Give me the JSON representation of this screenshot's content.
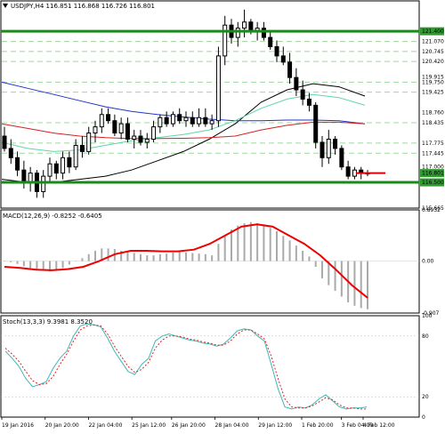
{
  "chart_data": {
    "type": "candlestick",
    "symbol": "USDJPY,H4",
    "ohlc_values": [
      "116.851",
      "116.868",
      "116.726",
      "116.801"
    ],
    "colors": {
      "background": "#ffffff",
      "panel_border": "#000000",
      "support_resistance": "#1a8a1a",
      "price_label_bg": "#2e9a2e",
      "level_dashed": "#9ed89e",
      "ma_black": "#000000",
      "ma_blue": "#2233cc",
      "ma_red": "#d62020",
      "ma_aqua": "#5ed6a8",
      "macd_hist": "#aaaaaa",
      "macd_signal": "#ee0000",
      "stoch_main": "#3fb8b8",
      "stoch_signal": "#dd2222",
      "current_price_line": "#dd0000",
      "candle_up_fill": "#ffffff",
      "candle_down_fill": "#000000"
    },
    "price_panel": {
      "ylim": [
        115.665,
        122.385
      ],
      "y_axis_labels": [
        "121.400",
        "121.070",
        "120.745",
        "120.420",
        "119.915",
        "119.750",
        "119.425",
        "118.760",
        "118.435",
        "117.775",
        "117.445",
        "117.000",
        "116.801",
        "116.500",
        "115.665"
      ],
      "highlighted_labels": [
        "121.400",
        "116.801",
        "116.500"
      ],
      "support_level": 116.5,
      "resistance_level": 121.4,
      "current_price": 116.801,
      "dashed_levels": [
        121.07,
        120.745,
        120.42,
        119.75,
        119.425,
        118.435,
        117.775,
        117.445
      ],
      "candles": [
        {
          "o": 118.0,
          "h": 118.3,
          "l": 117.5,
          "c": 117.6
        },
        {
          "o": 117.6,
          "h": 117.9,
          "l": 117.1,
          "c": 117.3
        },
        {
          "o": 117.3,
          "h": 117.5,
          "l": 116.7,
          "c": 116.9
        },
        {
          "o": 116.9,
          "h": 117.2,
          "l": 116.3,
          "c": 116.5
        },
        {
          "o": 116.5,
          "h": 117.0,
          "l": 116.2,
          "c": 116.8
        },
        {
          "o": 116.8,
          "h": 116.9,
          "l": 116.0,
          "c": 116.2
        },
        {
          "o": 116.2,
          "h": 116.9,
          "l": 116.0,
          "c": 116.7
        },
        {
          "o": 116.7,
          "h": 117.3,
          "l": 116.5,
          "c": 117.1
        },
        {
          "o": 117.1,
          "h": 117.2,
          "l": 116.6,
          "c": 116.8
        },
        {
          "o": 116.8,
          "h": 117.5,
          "l": 116.6,
          "c": 117.3
        },
        {
          "o": 117.3,
          "h": 117.5,
          "l": 116.8,
          "c": 117.0
        },
        {
          "o": 117.0,
          "h": 117.9,
          "l": 116.9,
          "c": 117.7
        },
        {
          "o": 117.7,
          "h": 118.0,
          "l": 117.3,
          "c": 117.5
        },
        {
          "o": 117.5,
          "h": 118.3,
          "l": 117.4,
          "c": 118.1
        },
        {
          "o": 118.1,
          "h": 118.5,
          "l": 117.8,
          "c": 118.3
        },
        {
          "o": 118.3,
          "h": 118.9,
          "l": 118.1,
          "c": 118.7
        },
        {
          "o": 118.7,
          "h": 118.9,
          "l": 118.4,
          "c": 118.5
        },
        {
          "o": 118.5,
          "h": 118.7,
          "l": 118.0,
          "c": 118.1
        },
        {
          "o": 118.1,
          "h": 118.6,
          "l": 117.9,
          "c": 118.4
        },
        {
          "o": 118.4,
          "h": 118.6,
          "l": 117.8,
          "c": 117.9
        },
        {
          "o": 117.9,
          "h": 118.2,
          "l": 117.6,
          "c": 118.0
        },
        {
          "o": 118.0,
          "h": 118.2,
          "l": 117.7,
          "c": 117.8
        },
        {
          "o": 117.8,
          "h": 118.1,
          "l": 117.6,
          "c": 117.9
        },
        {
          "o": 117.9,
          "h": 118.5,
          "l": 117.8,
          "c": 118.3
        },
        {
          "o": 118.3,
          "h": 118.7,
          "l": 118.1,
          "c": 118.6
        },
        {
          "o": 118.6,
          "h": 118.8,
          "l": 118.3,
          "c": 118.4
        },
        {
          "o": 118.4,
          "h": 118.8,
          "l": 118.3,
          "c": 118.7
        },
        {
          "o": 118.7,
          "h": 118.9,
          "l": 118.4,
          "c": 118.5
        },
        {
          "o": 118.5,
          "h": 118.8,
          "l": 118.3,
          "c": 118.6
        },
        {
          "o": 118.6,
          "h": 118.8,
          "l": 118.3,
          "c": 118.4
        },
        {
          "o": 118.4,
          "h": 118.9,
          "l": 118.3,
          "c": 118.6
        },
        {
          "o": 118.6,
          "h": 118.9,
          "l": 118.3,
          "c": 118.4
        },
        {
          "o": 118.4,
          "h": 118.7,
          "l": 118.2,
          "c": 118.5
        },
        {
          "o": 118.5,
          "h": 120.9,
          "l": 118.3,
          "c": 120.6
        },
        {
          "o": 120.6,
          "h": 121.9,
          "l": 120.3,
          "c": 121.6
        },
        {
          "o": 121.6,
          "h": 121.8,
          "l": 121.0,
          "c": 121.2
        },
        {
          "o": 121.2,
          "h": 121.7,
          "l": 120.9,
          "c": 121.5
        },
        {
          "o": 121.5,
          "h": 122.1,
          "l": 121.2,
          "c": 121.7
        },
        {
          "o": 121.7,
          "h": 121.8,
          "l": 121.3,
          "c": 121.4
        },
        {
          "o": 121.4,
          "h": 121.7,
          "l": 121.1,
          "c": 121.5
        },
        {
          "o": 121.5,
          "h": 121.7,
          "l": 121.1,
          "c": 121.2
        },
        {
          "o": 121.2,
          "h": 121.4,
          "l": 120.8,
          "c": 120.9
        },
        {
          "o": 120.9,
          "h": 121.1,
          "l": 120.4,
          "c": 120.6
        },
        {
          "o": 120.6,
          "h": 120.9,
          "l": 120.3,
          "c": 120.4
        },
        {
          "o": 120.4,
          "h": 120.7,
          "l": 119.7,
          "c": 119.9
        },
        {
          "o": 119.9,
          "h": 120.2,
          "l": 119.3,
          "c": 119.5
        },
        {
          "o": 119.5,
          "h": 119.8,
          "l": 119.0,
          "c": 119.2
        },
        {
          "o": 119.2,
          "h": 119.4,
          "l": 118.8,
          "c": 119.0
        },
        {
          "o": 119.0,
          "h": 119.1,
          "l": 117.6,
          "c": 117.8
        },
        {
          "o": 117.8,
          "h": 118.0,
          "l": 117.0,
          "c": 117.3
        },
        {
          "o": 117.3,
          "h": 118.2,
          "l": 117.1,
          "c": 117.9
        },
        {
          "o": 117.9,
          "h": 118.0,
          "l": 117.4,
          "c": 117.6
        },
        {
          "o": 117.6,
          "h": 117.7,
          "l": 116.9,
          "c": 117.0
        },
        {
          "o": 117.0,
          "h": 117.2,
          "l": 116.6,
          "c": 116.7
        },
        {
          "o": 116.7,
          "h": 117.0,
          "l": 116.6,
          "c": 116.9
        },
        {
          "o": 116.9,
          "h": 117.0,
          "l": 116.6,
          "c": 116.8
        },
        {
          "o": 116.8,
          "h": 116.9,
          "l": 116.7,
          "c": 116.8
        }
      ],
      "moving_averages": [
        {
          "color": "#000000",
          "values": [
            116.6,
            116.5,
            116.5,
            116.6,
            116.7,
            116.9,
            117.2,
            117.5,
            117.9,
            118.4,
            119.1,
            119.5,
            119.7,
            119.6,
            119.3
          ]
        },
        {
          "color": "#2233cc",
          "values": [
            119.75,
            119.55,
            119.35,
            119.15,
            118.95,
            118.8,
            118.7,
            118.62,
            118.55,
            118.5,
            118.5,
            118.52,
            118.52,
            118.5,
            118.4
          ]
        },
        {
          "color": "#d62020",
          "values": [
            118.4,
            118.25,
            118.1,
            118.0,
            117.95,
            117.92,
            117.92,
            117.93,
            117.95,
            118.0,
            118.2,
            118.35,
            118.45,
            118.45,
            118.4
          ]
        },
        {
          "color": "#5ed6a8",
          "values": [
            117.8,
            117.6,
            117.5,
            117.55,
            117.7,
            117.85,
            117.95,
            118.05,
            118.2,
            118.5,
            118.9,
            119.2,
            119.35,
            119.25,
            119.0
          ]
        }
      ]
    },
    "macd_panel": {
      "label": "MACD(12,26,9) -0.8252 -0.6405",
      "ylim": [
        -0.907,
        0.8932
      ],
      "y_axis_labels": [
        "0.8932",
        "0.00",
        "-0.907"
      ],
      "histogram": [
        0.0,
        -0.02,
        -0.05,
        -0.09,
        -0.12,
        -0.15,
        -0.17,
        -0.18,
        -0.15,
        -0.12,
        -0.06,
        0.0,
        0.05,
        0.12,
        0.18,
        0.22,
        0.22,
        0.21,
        0.18,
        0.16,
        0.14,
        0.12,
        0.1,
        0.1,
        0.12,
        0.13,
        0.15,
        0.16,
        0.15,
        0.14,
        0.13,
        0.12,
        0.1,
        0.3,
        0.45,
        0.55,
        0.62,
        0.66,
        0.68,
        0.66,
        0.64,
        0.58,
        0.52,
        0.44,
        0.36,
        0.27,
        0.18,
        0.08,
        -0.1,
        -0.3,
        -0.42,
        -0.52,
        -0.62,
        -0.72,
        -0.78,
        -0.82,
        -0.84
      ],
      "signal": [
        -0.1,
        -0.12,
        -0.15,
        -0.16,
        -0.14,
        -0.1,
        0.0,
        0.12,
        0.18,
        0.18,
        0.17,
        0.17,
        0.2,
        0.3,
        0.45,
        0.6,
        0.64,
        0.6,
        0.45,
        0.3,
        0.1,
        -0.15,
        -0.42,
        -0.64
      ]
    },
    "stoch_panel": {
      "label": "Stoch(13,3,3) 9.3981 8.3520",
      "ylim": [
        0,
        100
      ],
      "y_axis_labels": [
        "100",
        "80",
        "20",
        "0"
      ],
      "main": [
        65,
        58,
        50,
        38,
        30,
        32,
        35,
        48,
        58,
        65,
        80,
        90,
        92,
        91,
        89,
        78,
        65,
        55,
        45,
        42,
        52,
        58,
        75,
        80,
        82,
        80,
        78,
        76,
        75,
        73,
        72,
        70,
        72,
        78,
        85,
        87,
        86,
        80,
        75,
        52,
        28,
        10,
        8,
        10,
        9,
        12,
        18,
        22,
        16,
        10,
        8,
        9,
        9,
        10
      ],
      "signal": [
        68,
        62,
        55,
        45,
        36,
        32,
        33,
        40,
        52,
        62,
        75,
        86,
        90,
        91,
        90,
        82,
        70,
        60,
        50,
        44,
        47,
        54,
        68,
        76,
        80,
        80,
        79,
        77,
        76,
        74,
        73,
        71,
        71,
        75,
        82,
        86,
        86,
        82,
        77,
        60,
        38,
        18,
        10,
        9,
        9,
        11,
        15,
        19,
        17,
        12,
        9,
        9,
        8,
        8
      ]
    },
    "x_axis_labels": [
      "19 Jan 2016",
      "20 Jan 20:00",
      "22 Jan 04:00",
      "25 Jan 12:00",
      "26 Jan 20:00",
      "28 Jan 04:00",
      "29 Jan 12:00",
      "1 Feb 20:00",
      "3 Feb 04:00",
      "4 Feb 12:00"
    ],
    "x_axis_label_fractions": [
      0.0,
      0.12,
      0.24,
      0.36,
      0.47,
      0.59,
      0.71,
      0.83,
      0.94,
      1.0
    ]
  }
}
